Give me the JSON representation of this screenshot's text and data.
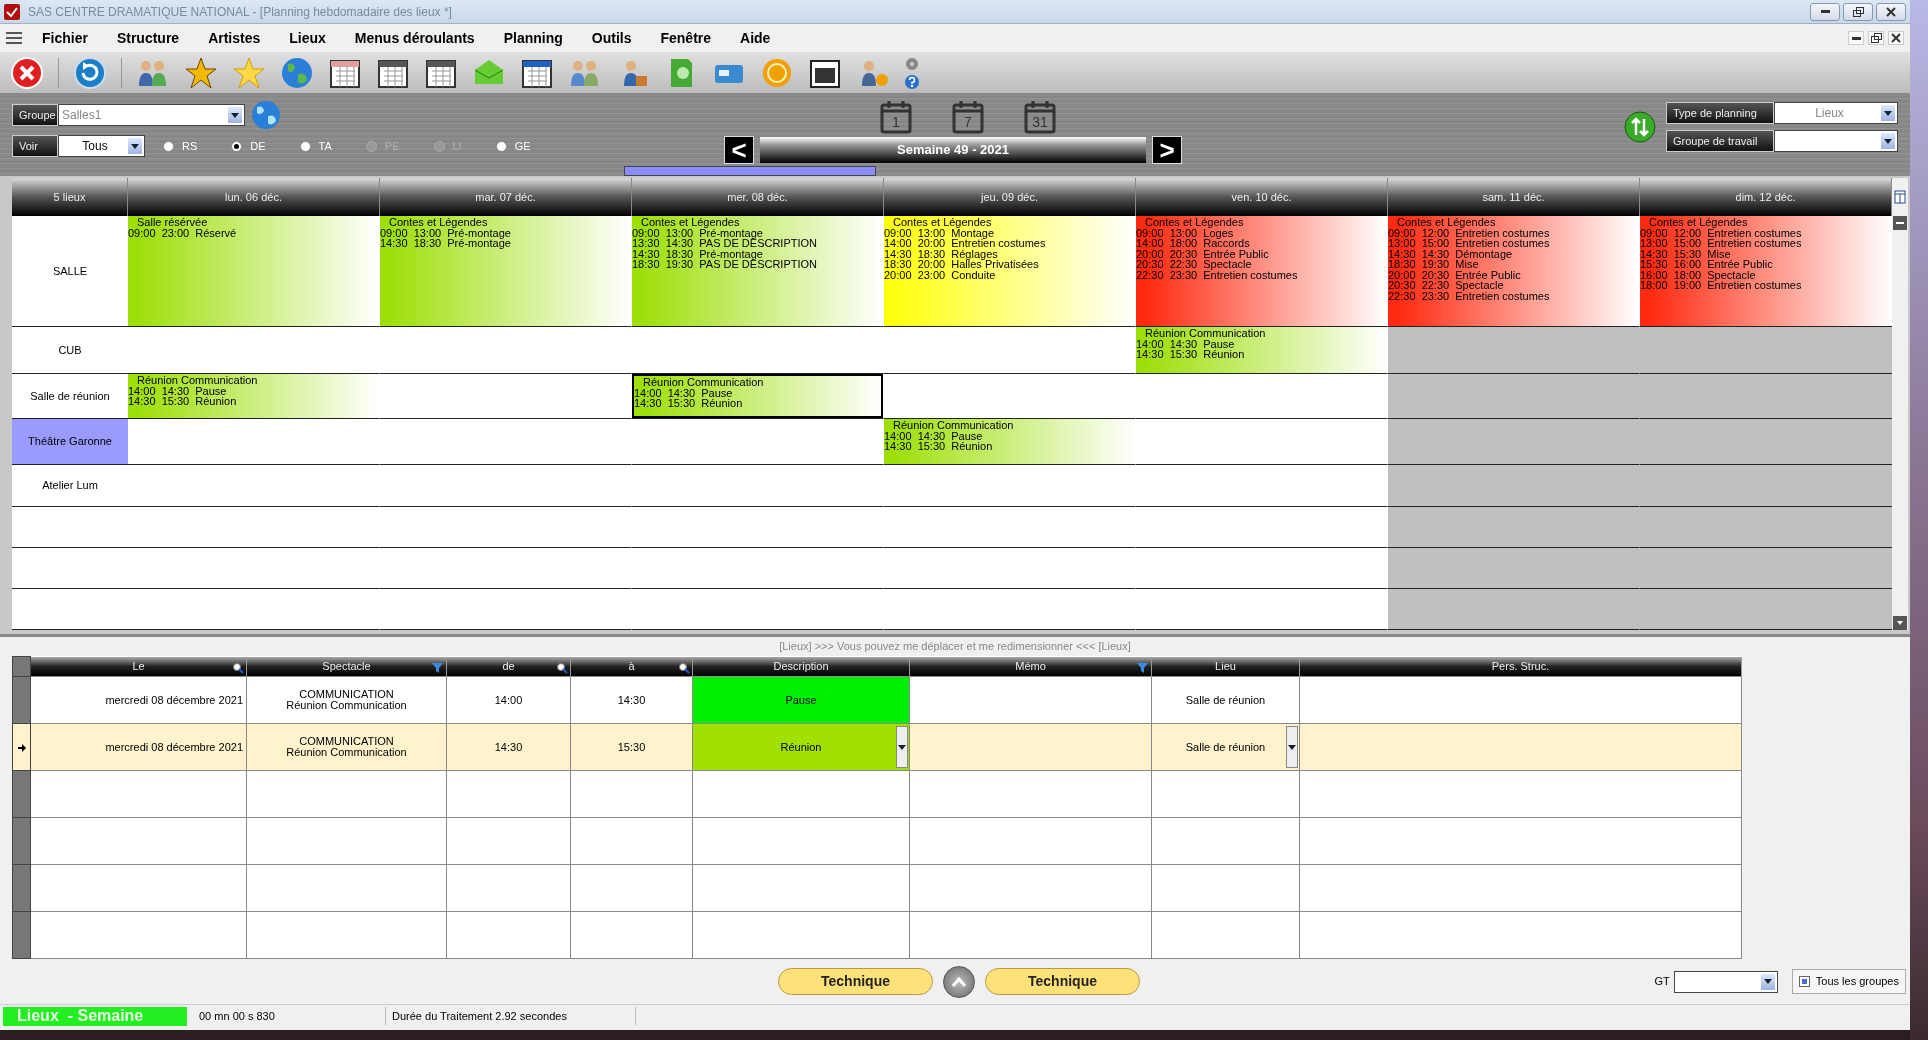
{
  "window": {
    "title": "SAS CENTRE DRAMATIQUE NATIONAL - [Planning hebdomadaire des lieux *]"
  },
  "menu": [
    "Fichier",
    "Structure",
    "Artistes",
    "Lieux",
    "Menus déroulants",
    "Planning",
    "Outils",
    "Fenêtre",
    "Aide"
  ],
  "filters": {
    "groupe": {
      "label": "Groupe",
      "value": "Salles1",
      "disabled": true
    },
    "voir": {
      "label": "Voir",
      "value": "Tous",
      "disabled": false
    },
    "radios": [
      {
        "label": "RS",
        "selected": false,
        "disabled": false
      },
      {
        "label": "DE",
        "selected": true,
        "disabled": false
      },
      {
        "label": "TA",
        "selected": false,
        "disabled": false
      },
      {
        "label": "PE",
        "selected": false,
        "disabled": true
      },
      {
        "label": "LI",
        "selected": false,
        "disabled": true
      },
      {
        "label": "GE",
        "selected": false,
        "disabled": false
      }
    ]
  },
  "view_buttons": [
    "1",
    "7",
    "31"
  ],
  "week_nav": {
    "prev": "<",
    "title": "Semaine 49 -  2021",
    "next": ">"
  },
  "right_filters": [
    {
      "label": "Type de planning",
      "value": "Lieux",
      "disabled": true
    },
    {
      "label": "Groupe de travail"
    }
  ],
  "planning": {
    "corner": "5 lieux",
    "days": [
      "lun. 06 déc.",
      "mar. 07 déc.",
      "mer. 08 déc.",
      "jeu. 09 déc.",
      "ven. 10 déc.",
      "sam. 11 déc.",
      "dim. 12 déc."
    ],
    "rows": [
      {
        "name": "SALLE",
        "selected": false,
        "cells": [
          {
            "closed": false,
            "event": {
              "title": "Salle résérvée",
              "color": "#9edf0a",
              "selected": false,
              "lines": [
                {
                  "start": "09:00",
                  "end": "23:00",
                  "label": "Réservé"
                }
              ]
            }
          },
          {
            "closed": false,
            "event": {
              "title": "Contes et Légendes",
              "color": "#9edf0a",
              "selected": false,
              "lines": [
                {
                  "start": "09:00",
                  "end": "13:00",
                  "label": "Pré-montage"
                },
                {
                  "start": "14:30",
                  "end": "18:30",
                  "label": "Pré-montage"
                }
              ]
            }
          },
          {
            "closed": false,
            "event": {
              "title": "Contes et Légendes",
              "color": "#9edf0a",
              "selected": false,
              "lines": [
                {
                  "start": "09:00",
                  "end": "13:00",
                  "label": "Pré-montage"
                },
                {
                  "start": "13:30",
                  "end": "14:30",
                  "label": "PAS DE DESCRIPTION"
                },
                {
                  "start": "14:30",
                  "end": "18:30",
                  "label": "Pré-montage"
                },
                {
                  "start": "18:30",
                  "end": "19:30",
                  "label": "PAS DE DESCRIPTION"
                }
              ]
            }
          },
          {
            "closed": false,
            "event": {
              "title": "Contes et Légendes",
              "color": "#ffff10",
              "selected": false,
              "lines": [
                {
                  "start": "09:00",
                  "end": "13:00",
                  "label": "Montage"
                },
                {
                  "start": "14:00",
                  "end": "20:00",
                  "label": "Entretien costumes"
                },
                {
                  "start": "14:30",
                  "end": "18:30",
                  "label": "Réglages"
                },
                {
                  "start": "18:30",
                  "end": "20:00",
                  "label": "Halles Privatisées"
                },
                {
                  "start": "20:00",
                  "end": "23:00",
                  "label": "Conduite"
                }
              ]
            }
          },
          {
            "closed": false,
            "event": {
              "title": "Contes et Légendes",
              "color": "#ff2a10",
              "selected": false,
              "lines": [
                {
                  "start": "09:00",
                  "end": "13:00",
                  "label": "Loges"
                },
                {
                  "start": "14:00",
                  "end": "18:00",
                  "label": "Raccords"
                },
                {
                  "start": "20:00",
                  "end": "20:30",
                  "label": "Entrée Public"
                },
                {
                  "start": "20:30",
                  "end": "22:30",
                  "label": "Spectacle"
                },
                {
                  "start": "22:30",
                  "end": "23:30",
                  "label": "Entretien costumes"
                }
              ]
            }
          },
          {
            "closed": false,
            "event": {
              "title": "Contes et Légendes",
              "color": "#ff2a10",
              "selected": false,
              "lines": [
                {
                  "start": "09:00",
                  "end": "12:00",
                  "label": "Entretien costumes"
                },
                {
                  "start": "13:00",
                  "end": "15:00",
                  "label": "Entretien costumes"
                },
                {
                  "start": "14:30",
                  "end": "14:30",
                  "label": "Démontage"
                },
                {
                  "start": "18:30",
                  "end": "19:30",
                  "label": "Mise"
                },
                {
                  "start": "20:00",
                  "end": "20:30",
                  "label": "Entrée Public"
                },
                {
                  "start": "20:30",
                  "end": "22:30",
                  "label": "Spectacle"
                },
                {
                  "start": "22:30",
                  "end": "23:30",
                  "label": "Entretien costumes"
                }
              ]
            }
          },
          {
            "closed": false,
            "event": {
              "title": "Contes et Légendes",
              "color": "#ff2a10",
              "selected": false,
              "lines": [
                {
                  "start": "09:00",
                  "end": "12:00",
                  "label": "Entretien costumes"
                },
                {
                  "start": "13:00",
                  "end": "15:00",
                  "label": "Entretien costumes"
                },
                {
                  "start": "14:30",
                  "end": "15:30",
                  "label": "Mise"
                },
                {
                  "start": "15:30",
                  "end": "16:00",
                  "label": "Entrée Public"
                },
                {
                  "start": "16:00",
                  "end": "18:00",
                  "label": "Spectacle"
                },
                {
                  "start": "18:00",
                  "end": "19:00",
                  "label": "Entretien costumes"
                }
              ]
            }
          }
        ]
      },
      {
        "name": "CUB",
        "selected": false,
        "cells": [
          {
            "closed": false
          },
          {
            "closed": false
          },
          {
            "closed": false
          },
          {
            "closed": false
          },
          {
            "closed": false,
            "event": {
              "title": "Réunion Communication",
              "color": "#9edf0a",
              "selected": false,
              "lines": [
                {
                  "start": "14:00",
                  "end": "14:30",
                  "label": "Pause"
                },
                {
                  "start": "14:30",
                  "end": "15:30",
                  "label": "Réunion"
                }
              ]
            }
          },
          {
            "closed": true
          },
          {
            "closed": true
          }
        ]
      },
      {
        "name": "Salle de réunion",
        "selected": false,
        "cells": [
          {
            "closed": false,
            "event": {
              "title": "Réunion Communication",
              "color": "#9edf0a",
              "selected": false,
              "lines": [
                {
                  "start": "14:00",
                  "end": "14:30",
                  "label": "Pause"
                },
                {
                  "start": "14:30",
                  "end": "15:30",
                  "label": "Réunion"
                }
              ]
            }
          },
          {
            "closed": false
          },
          {
            "closed": false,
            "event": {
              "title": "Réunion Communication",
              "color": "#9edf0a",
              "selected": true,
              "lines": [
                {
                  "start": "14:00",
                  "end": "14:30",
                  "label": "Pause"
                },
                {
                  "start": "14:30",
                  "end": "15:30",
                  "label": "Réunion"
                }
              ]
            }
          },
          {
            "closed": false
          },
          {
            "closed": false
          },
          {
            "closed": true
          },
          {
            "closed": true
          }
        ]
      },
      {
        "name": "Théâtre Garonne",
        "selected": true,
        "cells": [
          {
            "closed": false
          },
          {
            "closed": false
          },
          {
            "closed": false
          },
          {
            "closed": false,
            "event": {
              "title": "Réunion Communication",
              "color": "#9edf0a",
              "selected": false,
              "lines": [
                {
                  "start": "14:00",
                  "end": "14:30",
                  "label": "Pause"
                },
                {
                  "start": "14:30",
                  "end": "15:30",
                  "label": "Réunion"
                }
              ]
            }
          },
          {
            "closed": false
          },
          {
            "closed": true
          },
          {
            "closed": true
          }
        ]
      },
      {
        "name": "Atelier Lum",
        "selected": false,
        "cells": [
          {
            "closed": false
          },
          {
            "closed": false
          },
          {
            "closed": false
          },
          {
            "closed": false
          },
          {
            "closed": false
          },
          {
            "closed": true
          },
          {
            "closed": true
          }
        ]
      },
      {
        "selected": false,
        "cells": [
          {
            "closed": false
          },
          {
            "closed": false
          },
          {
            "closed": false
          },
          {
            "closed": false
          },
          {
            "closed": false
          },
          {
            "closed": true
          },
          {
            "closed": true
          }
        ]
      },
      {
        "selected": false,
        "cells": [
          {
            "closed": false
          },
          {
            "closed": false
          },
          {
            "closed": false
          },
          {
            "closed": false
          },
          {
            "closed": false
          },
          {
            "closed": true
          },
          {
            "closed": true
          }
        ]
      },
      {
        "selected": false,
        "cells": [
          {
            "closed": false
          },
          {
            "closed": false
          },
          {
            "closed": false
          },
          {
            "closed": false
          },
          {
            "closed": false
          },
          {
            "closed": true
          },
          {
            "closed": true
          }
        ]
      }
    ]
  },
  "splitter_hint": "[Lieux] >>> Vous pouvez me déplacer et me redimensionner <<< [Lieux]",
  "details": {
    "columns": [
      {
        "label": "Le",
        "kind": "search"
      },
      {
        "label": "Spectacle",
        "kind": "filter"
      },
      {
        "label": "de",
        "kind": "search"
      },
      {
        "label": "à",
        "kind": "search"
      },
      {
        "label": "Description"
      },
      {
        "label": "Mémo",
        "kind": "filter"
      },
      {
        "label": "Lieu"
      },
      {
        "label": "Pers. Struc."
      }
    ],
    "rows": [
      {
        "selected": false,
        "le": "mercredi 08 décembre 2021",
        "spectacle": [
          "COMMUNICATION",
          "Réunion Communication"
        ],
        "de": "14:00",
        "a": "14:30",
        "description": {
          "text": "Pause",
          "color": "#00ee00"
        },
        "lieu": "Salle de réunion"
      },
      {
        "selected": true,
        "le": "mercredi 08 décembre 2021",
        "spectacle": [
          "COMMUNICATION",
          "Réunion Communication"
        ],
        "de": "14:30",
        "a": "15:30",
        "description": {
          "text": "Réunion",
          "color": "#a2e000"
        },
        "lieu": "Salle de réunion"
      }
    ]
  },
  "bottom_buttons": [
    "Technique",
    "Technique"
  ],
  "gt": {
    "label": "GT"
  },
  "all_groups": {
    "label": "Tous les groupes",
    "checked": true
  },
  "status_bar": {
    "mode": "Lieux  - Semaine",
    "timer": "00 mn 00 s 830",
    "duration": "Durée du Traitement  2.92 secondes"
  }
}
